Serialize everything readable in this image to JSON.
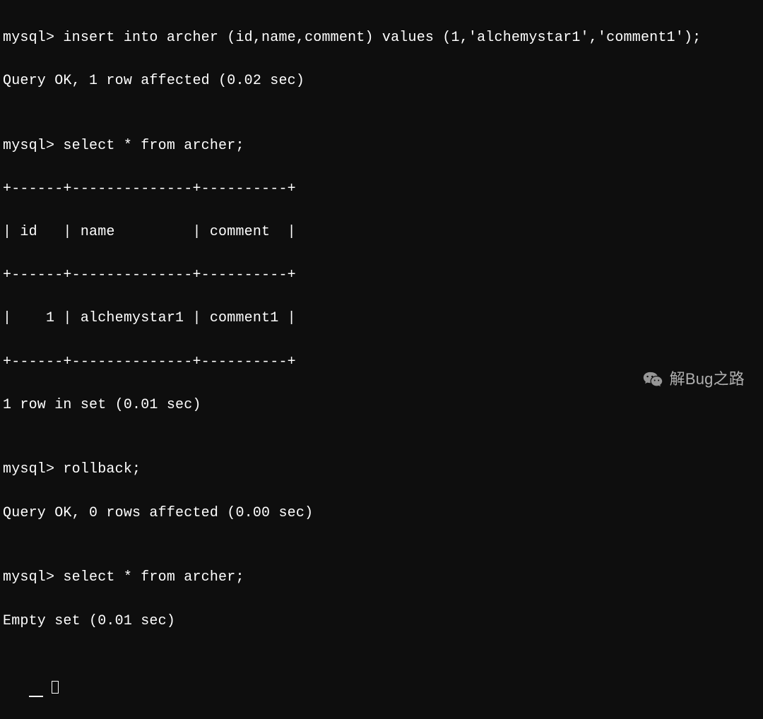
{
  "terminal": {
    "prompt": "mysql>",
    "lines": [
      "mysql> insert into archer (id,name,comment) values (1,'alchemystar1','comment1');",
      "Query OK, 1 row affected (0.02 sec)",
      "",
      "mysql> select * from archer;",
      "+------+--------------+----------+",
      "| id   | name         | comment  |",
      "+------+--------------+----------+",
      "|    1 | alchemystar1 | comment1 |",
      "+------+--------------+----------+",
      "1 row in set (0.01 sec)",
      "",
      "mysql> rollback;",
      "Query OK, 0 rows affected (0.00 sec)",
      "",
      "mysql> select * from archer;",
      "Empty set (0.01 sec)",
      ""
    ]
  },
  "watermark": {
    "text": "解Bug之路"
  },
  "chart_data": {
    "type": "table",
    "title": "archer table result",
    "columns": [
      "id",
      "name",
      "comment"
    ],
    "rows": [
      [
        1,
        "alchemystar1",
        "comment1"
      ]
    ]
  }
}
